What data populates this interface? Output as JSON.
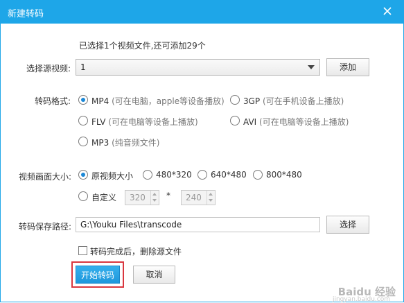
{
  "window": {
    "title": "新建转码"
  },
  "selection_info": "已选择1个视频文件,还可添加29个",
  "source": {
    "label": "选择源视频:",
    "value": "1",
    "add_button": "添加"
  },
  "format": {
    "label": "转码格式:",
    "options": [
      {
        "name": "MP4",
        "hint": "(可在电脑，apple等设备播放)",
        "checked": true
      },
      {
        "name": "3GP",
        "hint": "(可在手机设备上播放)",
        "checked": false
      },
      {
        "name": "FLV",
        "hint": "(可在电脑等设备上播放)",
        "checked": false
      },
      {
        "name": "AVI",
        "hint": "(可在电脑等设备上播放)",
        "checked": false
      },
      {
        "name": "MP3",
        "hint": "(纯音频文件)",
        "checked": false
      }
    ]
  },
  "size": {
    "label": "视频画面大小:",
    "options": [
      "原视频大小",
      "480*320",
      "640*480",
      "800*480"
    ],
    "selected": "原视频大小",
    "custom_label": "自定义",
    "custom_width": "320",
    "separator": "*",
    "custom_height": "240"
  },
  "save_path": {
    "label": "转码保存路径:",
    "value": "G:\\Youku Files\\transcode",
    "browse_button": "选择"
  },
  "delete_source": {
    "label": "转码完成后，删除源文件",
    "checked": false
  },
  "actions": {
    "start": "开始转码",
    "cancel": "取消"
  },
  "watermark": {
    "brand": "Baidu 经验",
    "url": "jingyan.baidu.com"
  },
  "colors": {
    "titlebar": "#1ea6e8",
    "primary": "#2aa6e6",
    "highlight_border": "#d9363e"
  }
}
